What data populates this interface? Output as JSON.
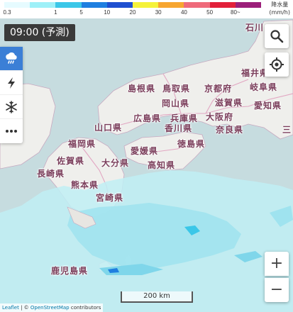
{
  "legend": {
    "colors": [
      "#e6fbff",
      "#9ef0f8",
      "#3bc7e8",
      "#1f7fe0",
      "#1f4fd0",
      "#f5f23a",
      "#f7a630",
      "#ef6a7b",
      "#e2203a",
      "#9c1f7a"
    ],
    "ticks": [
      "0.3",
      "1",
      "5",
      "10",
      "20",
      "30",
      "40",
      "50",
      "80~"
    ],
    "unit_title": "降水量",
    "unit": "(mm/h)"
  },
  "time_badge": "09:00 (予測)",
  "layers": [
    {
      "name": "rain-icon",
      "active": true
    },
    {
      "name": "lightning-icon",
      "active": false
    },
    {
      "name": "snow-icon",
      "active": false
    },
    {
      "name": "more-icon",
      "active": false
    }
  ],
  "places": {
    "ishikawa": "石川",
    "fukui": "福井県",
    "gifu": "岐阜県",
    "kyoto": "京都府",
    "shiga": "滋賀県",
    "aichi": "愛知県",
    "osaka": "大阪府",
    "nara": "奈良県",
    "mie": "三",
    "shimane": "島根県",
    "tottori": "鳥取県",
    "okayama": "岡山県",
    "hiroshima": "広島県",
    "hyogo": "兵庫県",
    "yamaguchi": "山口県",
    "kagawa": "香川県",
    "tokushima": "徳島県",
    "ehime": "愛媛県",
    "kochi": "高知県",
    "fukuoka": "福岡県",
    "saga": "佐賀県",
    "oita": "大分県",
    "nagasaki": "長崎県",
    "kumamoto": "熊本県",
    "miyazaki": "宮崎県",
    "kagoshima": "鹿児島県"
  },
  "scalebar": "200 km",
  "attribution": {
    "leaflet": "Leaflet",
    "sep": " | © ",
    "osm": "OpenStreetMap",
    "contrib": " contributors"
  },
  "controls": {
    "zoom_in": "+",
    "zoom_out": "−"
  }
}
